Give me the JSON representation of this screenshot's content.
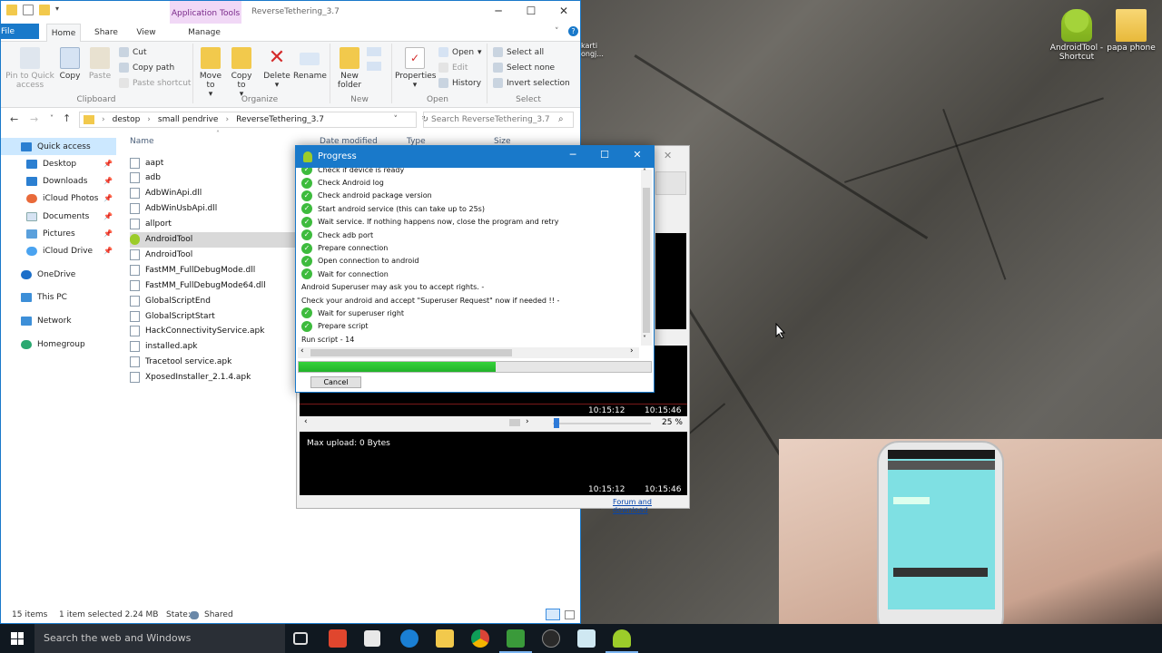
{
  "explorer": {
    "context_tab": "Application Tools",
    "window_title": "ReverseTethering_3.7",
    "ribbon_tabs": [
      "File",
      "Home",
      "Share",
      "View",
      "Manage"
    ],
    "ribbon": {
      "pin": "Pin to Quick access",
      "copy": "Copy",
      "paste": "Paste",
      "cut": "Cut",
      "copy_path": "Copy path",
      "paste_shortcut": "Paste shortcut",
      "group_clipboard": "Clipboard",
      "move_to": "Move to",
      "copy_to": "Copy to",
      "delete": "Delete",
      "rename": "Rename",
      "group_organize": "Organize",
      "new_folder": "New folder",
      "group_new": "New",
      "properties": "Properties",
      "open": "Open",
      "edit": "Edit",
      "history": "History",
      "group_open": "Open",
      "select_all": "Select all",
      "select_none": "Select none",
      "invert_selection": "Invert selection",
      "group_select": "Select"
    },
    "breadcrumb": [
      "destop",
      "small pendrive",
      "ReverseTethering_3.7"
    ],
    "search_placeholder": "Search ReverseTethering_3.7",
    "nav": [
      "Quick access",
      "Desktop",
      "Downloads",
      "iCloud Photos",
      "Documents",
      "Pictures",
      "iCloud Drive",
      "OneDrive",
      "This PC",
      "Network",
      "Homegroup"
    ],
    "columns": [
      "Name",
      "Date modified",
      "Type",
      "Size"
    ],
    "files": [
      "aapt",
      "adb",
      "AdbWinApi.dll",
      "AdbWinUsbApi.dll",
      "allport",
      "AndroidTool",
      "AndroidTool",
      "FastMM_FullDebugMode.dll",
      "FastMM_FullDebugMode64.dll",
      "GlobalScriptEnd",
      "GlobalScriptStart",
      "HackConnectivityService.apk",
      "installed.apk",
      "Tracetool service.apk",
      "XposedInstaller_2.1.4.apk"
    ],
    "status": {
      "items": "15 items",
      "selected": "1 item selected  2.24 MB",
      "state": "State:",
      "shared": "Shared"
    }
  },
  "desktop_icons": [
    {
      "label": "AndroidTool - Shortcut"
    },
    {
      "label": "papa phone"
    }
  ],
  "desktop_partial_label": "karti ongj...",
  "progress": {
    "title": "Progress",
    "log": [
      {
        "text": "Check if device is ready",
        "ok": true
      },
      {
        "text": "Check Android log",
        "ok": true
      },
      {
        "text": "Check android package version",
        "ok": true
      },
      {
        "text": "Start android service (this can take up to 25s)",
        "ok": true
      },
      {
        "text": "Wait service. If nothing happens now, close the program and retry",
        "ok": true
      },
      {
        "text": "Check adb port",
        "ok": true
      },
      {
        "text": "Prepare connection",
        "ok": true
      },
      {
        "text": "Open connection to android",
        "ok": true
      },
      {
        "text": "Wait for connection",
        "ok": true
      },
      {
        "text": "Android Superuser may ask you to accept rights.  -",
        "ok": false
      },
      {
        "text": "Check your android and accept \"Superuser Request\" now if needed !!  -",
        "ok": false
      },
      {
        "text": "Wait for superuser right",
        "ok": true
      },
      {
        "text": "Prepare script",
        "ok": true
      },
      {
        "text": "Run script  -  14",
        "ok": false
      }
    ],
    "progress_fraction": 0.56,
    "cancel": "Cancel"
  },
  "appwin": {
    "time_a1": "10:15:12",
    "time_a2": "10:15:46",
    "zoom": "25 %",
    "max_upload": "Max upload: 0 Bytes",
    "time_b1": "10:15:12",
    "time_b2": "10:15:46",
    "forum_link": "Forum and download"
  },
  "taskbar": {
    "search": "Search the web and Windows"
  },
  "colors": {
    "accent": "#1979ca",
    "progress_green": "#22b12a",
    "check_green": "#3dbb3d"
  }
}
